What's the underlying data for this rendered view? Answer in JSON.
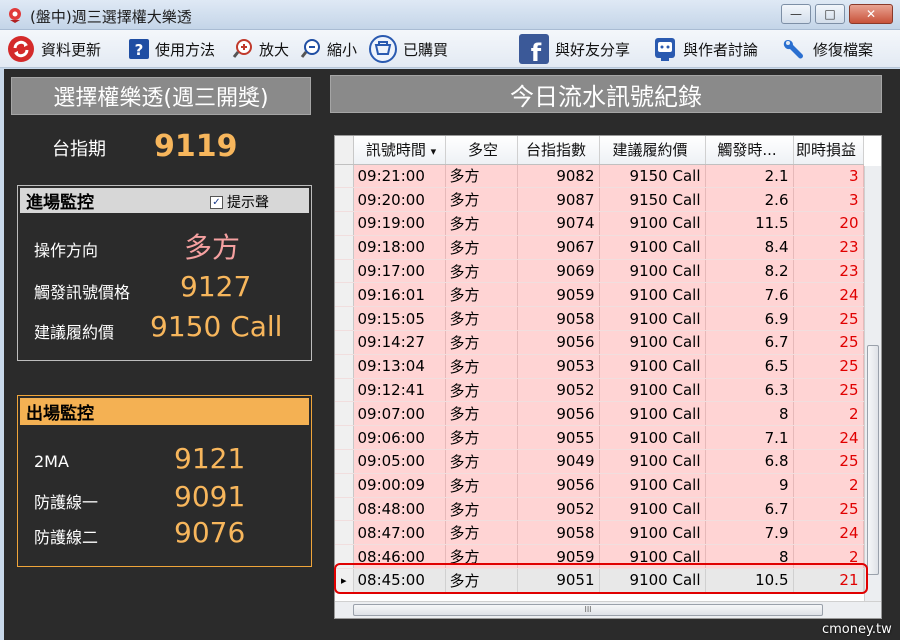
{
  "window": {
    "title": "(盤中)週三選擇權大樂透",
    "close_glyph": "✕",
    "min_glyph": "—",
    "max_glyph": "□"
  },
  "toolbar": {
    "refresh": "資料更新",
    "help": "使用方法",
    "zoom_in": "放大",
    "zoom_out": "縮小",
    "purchased": "已購買",
    "share": "與好友分享",
    "discuss": "與作者討論",
    "repair": "修復檔案"
  },
  "left": {
    "header": "選擇權樂透(週三開獎)",
    "index_label": "台指期",
    "index_value": "9119",
    "entry": {
      "title": "進場監控",
      "alert_label": "提示聲",
      "alert_checked": "✓",
      "direction_label": "操作方向",
      "direction_value": "多方",
      "trigger_label": "觸發訊號價格",
      "trigger_value": "9127",
      "strike_label": "建議履約價",
      "strike_value": "9150 Call"
    },
    "exit": {
      "title": "出場監控",
      "ma_label": "2MA",
      "ma_value": "9121",
      "line1_label": "防護線一",
      "line1_value": "9091",
      "line2_label": "防護線二",
      "line2_value": "9076"
    }
  },
  "right": {
    "header": "今日流水訊號紀錄",
    "columns": [
      "訊號時間",
      "多空",
      "台指指數",
      "建議履約價",
      "觸發時...",
      "即時損益"
    ],
    "sort_glyph": "▾",
    "rows": [
      [
        "09:21:00",
        "多方",
        "9082",
        "9150 Call",
        "2.1",
        "3"
      ],
      [
        "09:20:00",
        "多方",
        "9087",
        "9150 Call",
        "2.6",
        "3"
      ],
      [
        "09:19:00",
        "多方",
        "9074",
        "9100 Call",
        "11.5",
        "20"
      ],
      [
        "09:18:00",
        "多方",
        "9067",
        "9100 Call",
        "8.4",
        "23"
      ],
      [
        "09:17:00",
        "多方",
        "9069",
        "9100 Call",
        "8.2",
        "23"
      ],
      [
        "09:16:01",
        "多方",
        "9059",
        "9100 Call",
        "7.6",
        "24"
      ],
      [
        "09:15:05",
        "多方",
        "9058",
        "9100 Call",
        "6.9",
        "25"
      ],
      [
        "09:14:27",
        "多方",
        "9056",
        "9100 Call",
        "6.7",
        "25"
      ],
      [
        "09:13:04",
        "多方",
        "9053",
        "9100 Call",
        "6.5",
        "25"
      ],
      [
        "09:12:41",
        "多方",
        "9052",
        "9100 Call",
        "6.3",
        "25"
      ],
      [
        "09:07:00",
        "多方",
        "9056",
        "9100 Call",
        "8",
        "2"
      ],
      [
        "09:06:00",
        "多方",
        "9055",
        "9100 Call",
        "7.1",
        "24"
      ],
      [
        "09:05:00",
        "多方",
        "9049",
        "9100 Call",
        "6.8",
        "25"
      ],
      [
        "09:00:09",
        "多方",
        "9056",
        "9100 Call",
        "9",
        "2"
      ],
      [
        "08:48:00",
        "多方",
        "9052",
        "9100 Call",
        "6.7",
        "25"
      ],
      [
        "08:47:00",
        "多方",
        "9058",
        "9100 Call",
        "7.9",
        "24"
      ],
      [
        "08:46:00",
        "多方",
        "9059",
        "9100 Call",
        "8",
        "2"
      ],
      [
        "08:45:00",
        "多方",
        "9051",
        "9100 Call",
        "10.5",
        "21"
      ]
    ],
    "row_pointer": "▸",
    "hscroll_grip": "III"
  },
  "watermark": "cmoney.tw",
  "colors": {
    "panel_bg": "#2b2b2b",
    "value_orange": "#f7b65c",
    "row_pink": "#ffd4d4",
    "highlight_red": "#e00000"
  }
}
